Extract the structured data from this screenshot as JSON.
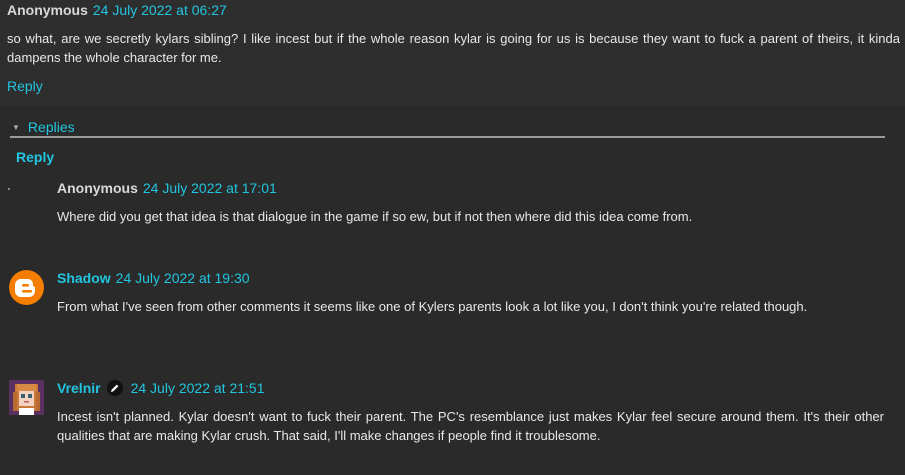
{
  "top_comment": {
    "author": "Anonymous",
    "timestamp": "24 July 2022 at 06:27",
    "text": "so what, are we secretly kylars sibling? I like incest but if the whole reason kylar is going for us is because they want to fuck a parent of theirs, it kinda dampens the whole character for me.",
    "reply_label": "Reply"
  },
  "thread": {
    "replies_toggle_label": "Replies",
    "reply_label": "Reply",
    "replies": [
      {
        "author": "Anonymous",
        "timestamp": "24 July 2022 at 17:01",
        "text": "Where did you get that idea is that dialogue in the game if so ew, but if not then where did this idea come from."
      },
      {
        "author": "Shadow",
        "timestamp": "24 July 2022 at 19:30",
        "avatar_icon": "blogger-icon",
        "text": "From what I've seen from other comments it seems like one of Kylers parents look a lot like you, I don't think you're related though."
      },
      {
        "author": "Vrelnir",
        "timestamp": "24 July 2022 at 21:51",
        "avatar_icon": "pixel-portrait-avatar",
        "badge_icon": "pencil-icon",
        "text": "Incest isn't planned. Kylar doesn't want to fuck their parent. The PC's resemblance just makes Kylar feel secure around them. It's their other qualities that are making Kylar crush. That said, I'll make changes if people find it troublesome."
      }
    ]
  },
  "colors": {
    "link": "#21c6e0",
    "background": "#2e2e2e",
    "blogger": "#f57d00"
  }
}
